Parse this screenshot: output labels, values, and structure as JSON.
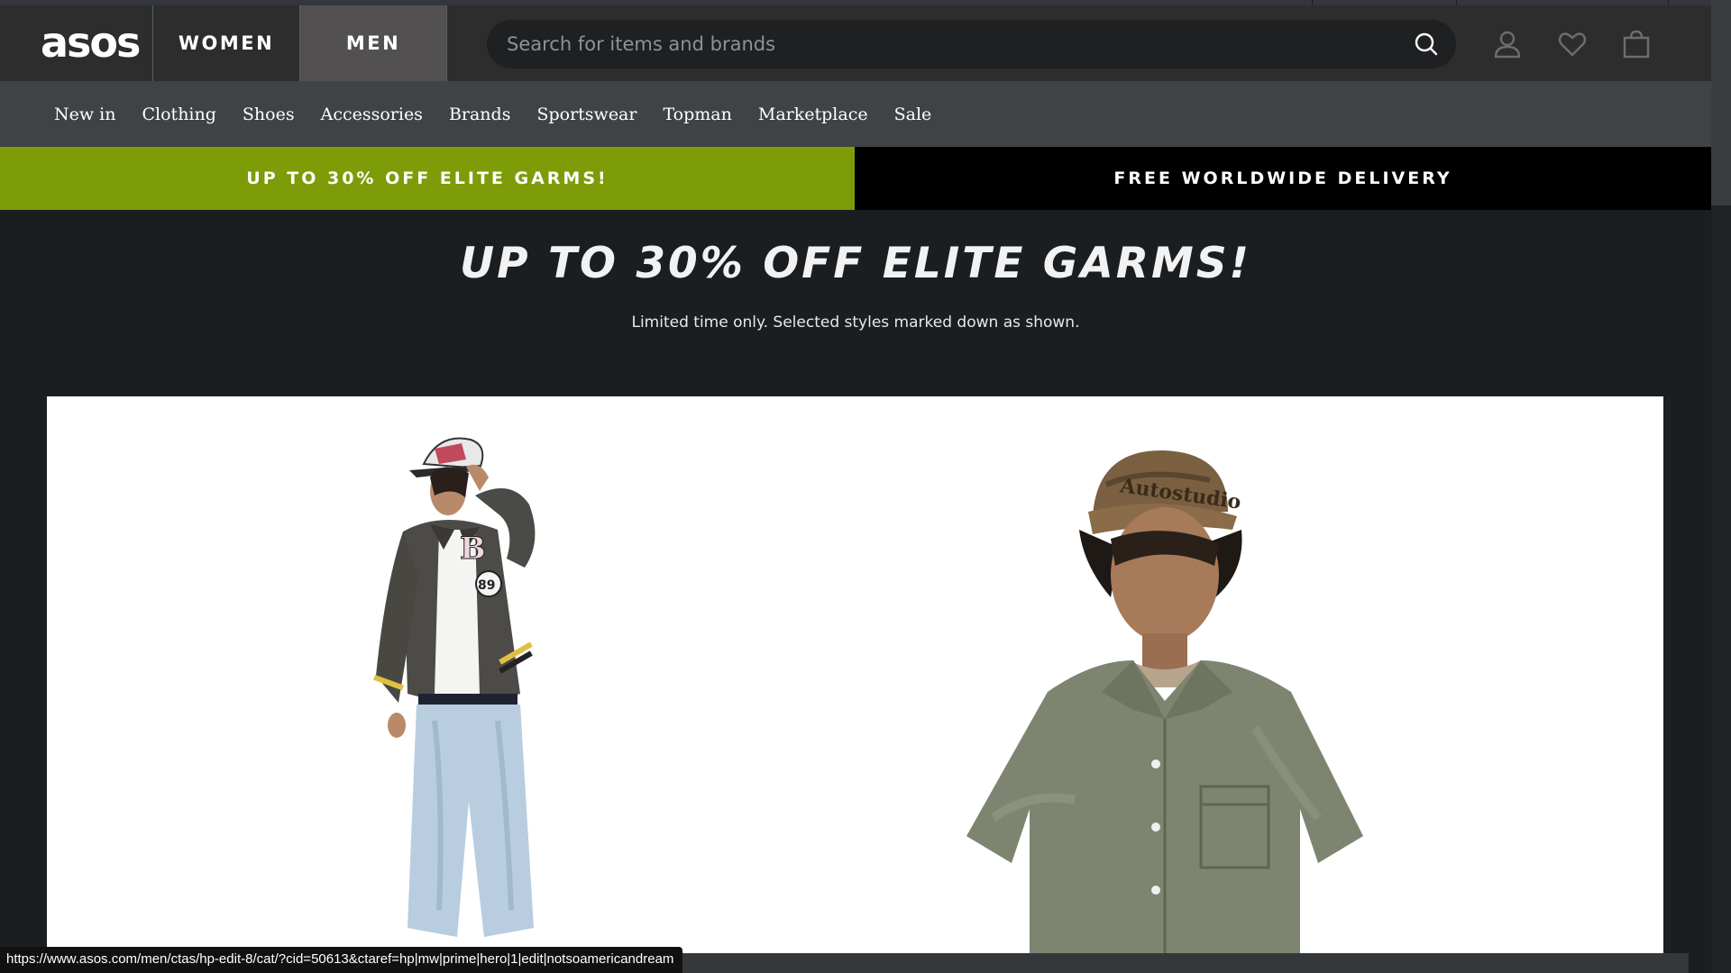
{
  "header": {
    "logo": "asos",
    "tabs": [
      {
        "label": "WOMEN",
        "active": false
      },
      {
        "label": "MEN",
        "active": true
      }
    ],
    "search_placeholder": "Search for items and brands",
    "icons": [
      "search-icon",
      "account-icon",
      "heart-icon",
      "bag-icon"
    ]
  },
  "nav": {
    "items": [
      "New in",
      "Clothing",
      "Shoes",
      "Accessories",
      "Brands",
      "Sportswear",
      "Topman",
      "Marketplace",
      "Sale"
    ]
  },
  "promos": {
    "left": "UP TO 30% OFF ELITE GARMS!",
    "right": "FREE WORLDWIDE DELIVERY"
  },
  "hero": {
    "title": "UP TO 30% OFF ELITE GARMS!",
    "subtitle": "Limited time only. Selected styles marked down as shown."
  },
  "status_bar": {
    "url": "https://www.asos.com/men/ctas/hp-edit-8/cat/?cid=50613&ctaref=hp|mw|prime|hero|1|edit|notsoamericandream"
  },
  "colors": {
    "header_bg": "#2d2d2d",
    "nav_bg": "#3f4346",
    "promo_green": "#7e9b08",
    "page_bg": "#1b1e21"
  }
}
